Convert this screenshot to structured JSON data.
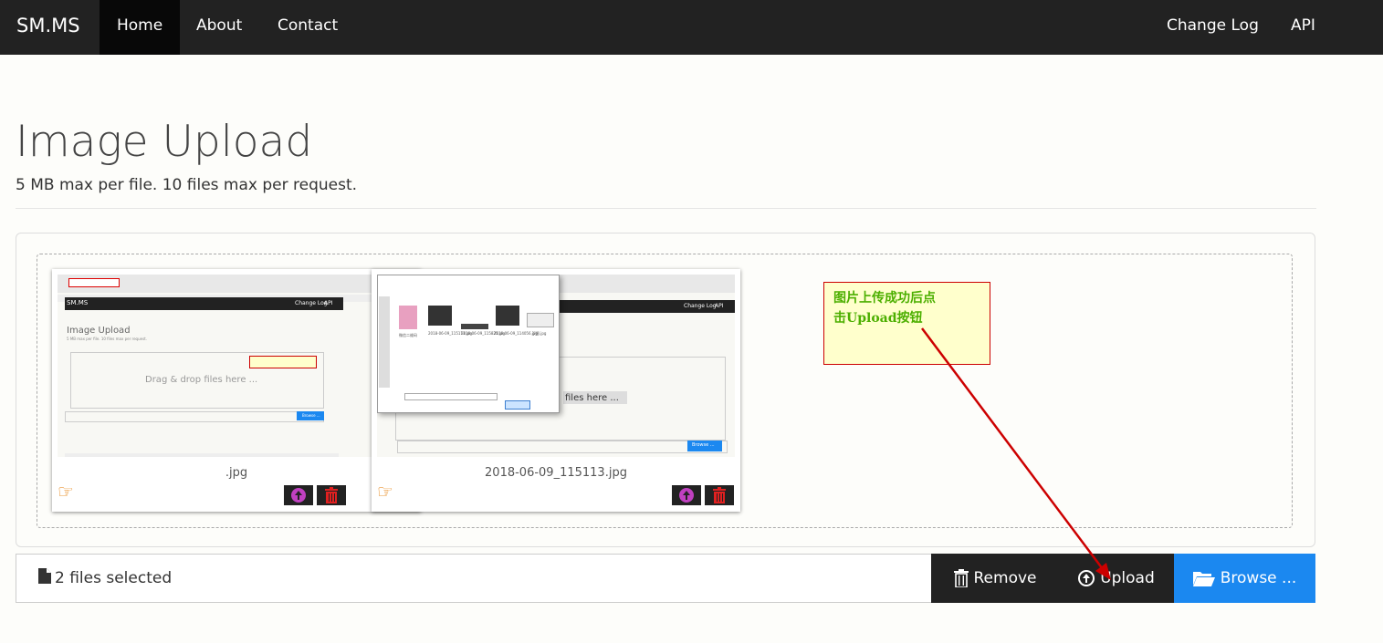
{
  "nav": {
    "brand": "SM.MS",
    "items": [
      "Home",
      "About",
      "Contact"
    ],
    "right_items": [
      "Change Log",
      "API"
    ]
  },
  "page": {
    "title": "Image Upload",
    "subtitle": "5 MB max per file. 10 files max per request."
  },
  "files": [
    {
      "name": ".jpg"
    },
    {
      "name": "2018-06-09_115113.jpg"
    }
  ],
  "thumb1": {
    "title": "Image Upload",
    "subtitle": "5 MB max per file. 10 files max per request.",
    "drop": "Drag & drop files here ...",
    "browse": "Browse ...",
    "change_log": "Change Log",
    "api": "API"
  },
  "thumb2": {
    "drop": "files here ...",
    "browse": "Browse ...",
    "change_log": "Change Log",
    "api": "API",
    "file_labels": [
      "微信二维码",
      "2018-06-09_115113.jpg",
      "2018-06-09_115825.jpg",
      "2018-06-09_114056.jpg",
      "汉图.jpg"
    ]
  },
  "annotation": {
    "line1": "图片上传成功后点",
    "line2": "击Upload按钮"
  },
  "upload_bar": {
    "selected": "2 files selected",
    "remove": "Remove",
    "upload": "Upload",
    "browse": "Browse ..."
  },
  "colors": {
    "navbar": "#222222",
    "primary": "#1b88f0",
    "annotation_arrow": "#cc0000",
    "annotation_text": "#4caf00"
  },
  "icons": [
    "file-icon",
    "trash-icon",
    "upload-circle-icon",
    "folder-open-icon",
    "zoom-hand-icon"
  ]
}
